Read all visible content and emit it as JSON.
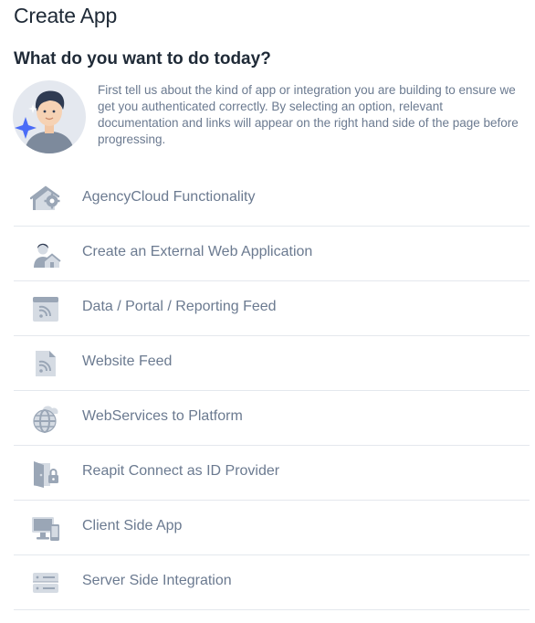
{
  "page": {
    "title": "Create App",
    "question": "What do you want to do today?",
    "intro": "First tell us about the kind of app or integration you are building to ensure we get you authenticated correctly. By selecting an option, relevant documentation and links will appear on the right hand side of the page before progressing."
  },
  "options": [
    {
      "label": "AgencyCloud Functionality",
      "icon": "house-gear-icon"
    },
    {
      "label": "Create an External Web Application",
      "icon": "person-house-icon"
    },
    {
      "label": "Data / Portal / Reporting Feed",
      "icon": "feed-window-icon"
    },
    {
      "label": "Website Feed",
      "icon": "feed-document-icon"
    },
    {
      "label": "WebServices to Platform",
      "icon": "globe-cloud-icon"
    },
    {
      "label": "Reapit Connect as ID Provider",
      "icon": "door-lock-icon"
    },
    {
      "label": "Client Side App",
      "icon": "devices-icon"
    },
    {
      "label": "Server Side Integration",
      "icon": "server-icon"
    }
  ],
  "colors": {
    "heading": "#1f2a37",
    "body_text": "#6b7a90",
    "icon_dark": "#9aa6b6",
    "icon_light": "#d5dbe3",
    "divider": "#e4e8ed",
    "avatar_accent": "#4a6cf7"
  }
}
